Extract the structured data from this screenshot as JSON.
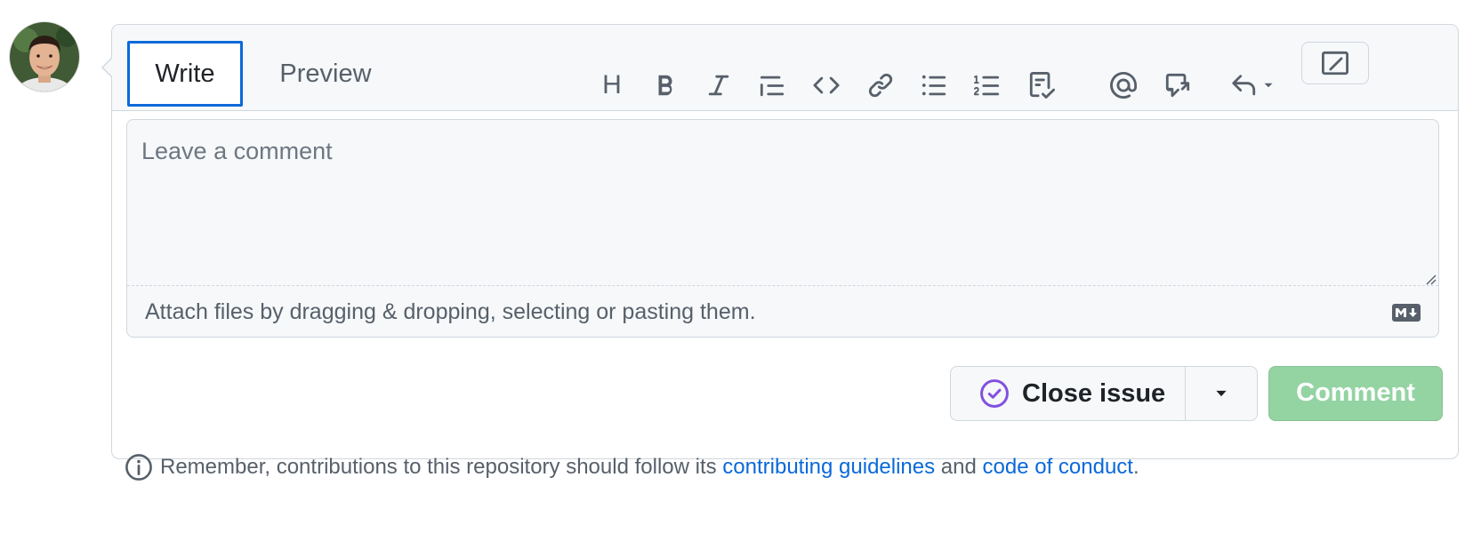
{
  "avatar": {
    "alt": "User avatar"
  },
  "editor": {
    "tabs": [
      {
        "label": "Write",
        "active": true
      },
      {
        "label": "Preview",
        "active": false
      }
    ],
    "toolbar": {
      "items": [
        {
          "icon": "heading-icon",
          "glyph": "H"
        },
        {
          "icon": "bold-icon"
        },
        {
          "icon": "italic-icon"
        },
        {
          "icon": "quote-icon"
        },
        {
          "icon": "code-icon"
        },
        {
          "icon": "link-icon"
        },
        {
          "icon": "unordered-list-icon"
        },
        {
          "icon": "ordered-list-icon"
        },
        {
          "icon": "task-list-icon"
        },
        {
          "icon": "mention-icon"
        },
        {
          "icon": "cross-reference-icon"
        },
        {
          "icon": "saved-replies-icon"
        },
        {
          "icon": "fullscreen-icon"
        }
      ]
    },
    "textarea": {
      "placeholder": "Leave a comment",
      "value": ""
    },
    "attach_text": "Attach files by dragging & dropping, selecting or pasting them."
  },
  "actions": {
    "close_issue_label": "Close issue",
    "comment_label": "Comment"
  },
  "note": {
    "prefix": "Remember, contributions to this repository should follow its ",
    "link1": "contributing guidelines",
    "middle": " and ",
    "link2": "code of conduct",
    "suffix": "."
  },
  "colors": {
    "accent": "#0969da",
    "comment_button": "#94d3a2",
    "close_icon": "#8250df",
    "border": "#d0d7de",
    "muted_text": "#57606a"
  }
}
